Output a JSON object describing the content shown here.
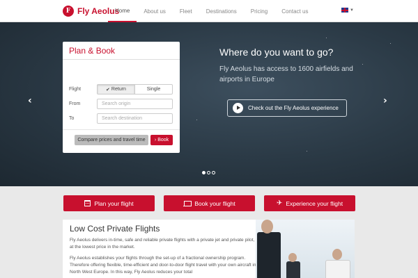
{
  "brand": {
    "logo_text": "F",
    "name": "Fly Aeolus"
  },
  "nav": {
    "items": [
      {
        "label": "Home",
        "active": true
      },
      {
        "label": "About us"
      },
      {
        "label": "Fleet"
      },
      {
        "label": "Destinations"
      },
      {
        "label": "Pricing"
      },
      {
        "label": "Contact us"
      }
    ],
    "language": "en-GB"
  },
  "hero": {
    "carousel": {
      "prev": "‹",
      "next": "›",
      "slides": 3,
      "active_slide": 1
    },
    "booking": {
      "title": "Plan & Book",
      "flight_label": "Flight",
      "return_label": "Return",
      "single_label": "Single",
      "selected": "Return",
      "from_label": "From",
      "from_placeholder": "Search origin",
      "to_label": "To",
      "to_placeholder": "Search destination",
      "compare_label": "Compare prices and travel time",
      "book_label": "Book"
    },
    "title": "Where do you want to go?",
    "subtitle": "Fly Aeolus has access to 1600 airfields and airports in Europe",
    "experience_label": "Check out the Fly Aeolus experience"
  },
  "cta": {
    "plan": "Plan your flight",
    "book": "Book your flight",
    "experience": "Experience your flight"
  },
  "content": {
    "title": "Low Cost Private Flights",
    "p1": "Fly Aeolus delivers in-time, safe and reliable private flights with a private jet and private pilot, at the lowest price in the market.",
    "p2": "Fly Aeolus establishes your flights through the set-up of a fractional ownership program. Therefore offering flexible, time-efficient and door-to-door flight travel with your own aircraft in North West Europe. In this way, Fly Aeolus reduces your total"
  },
  "colors": {
    "accent": "#c8102e",
    "hero_bg": "#2b3a46"
  }
}
